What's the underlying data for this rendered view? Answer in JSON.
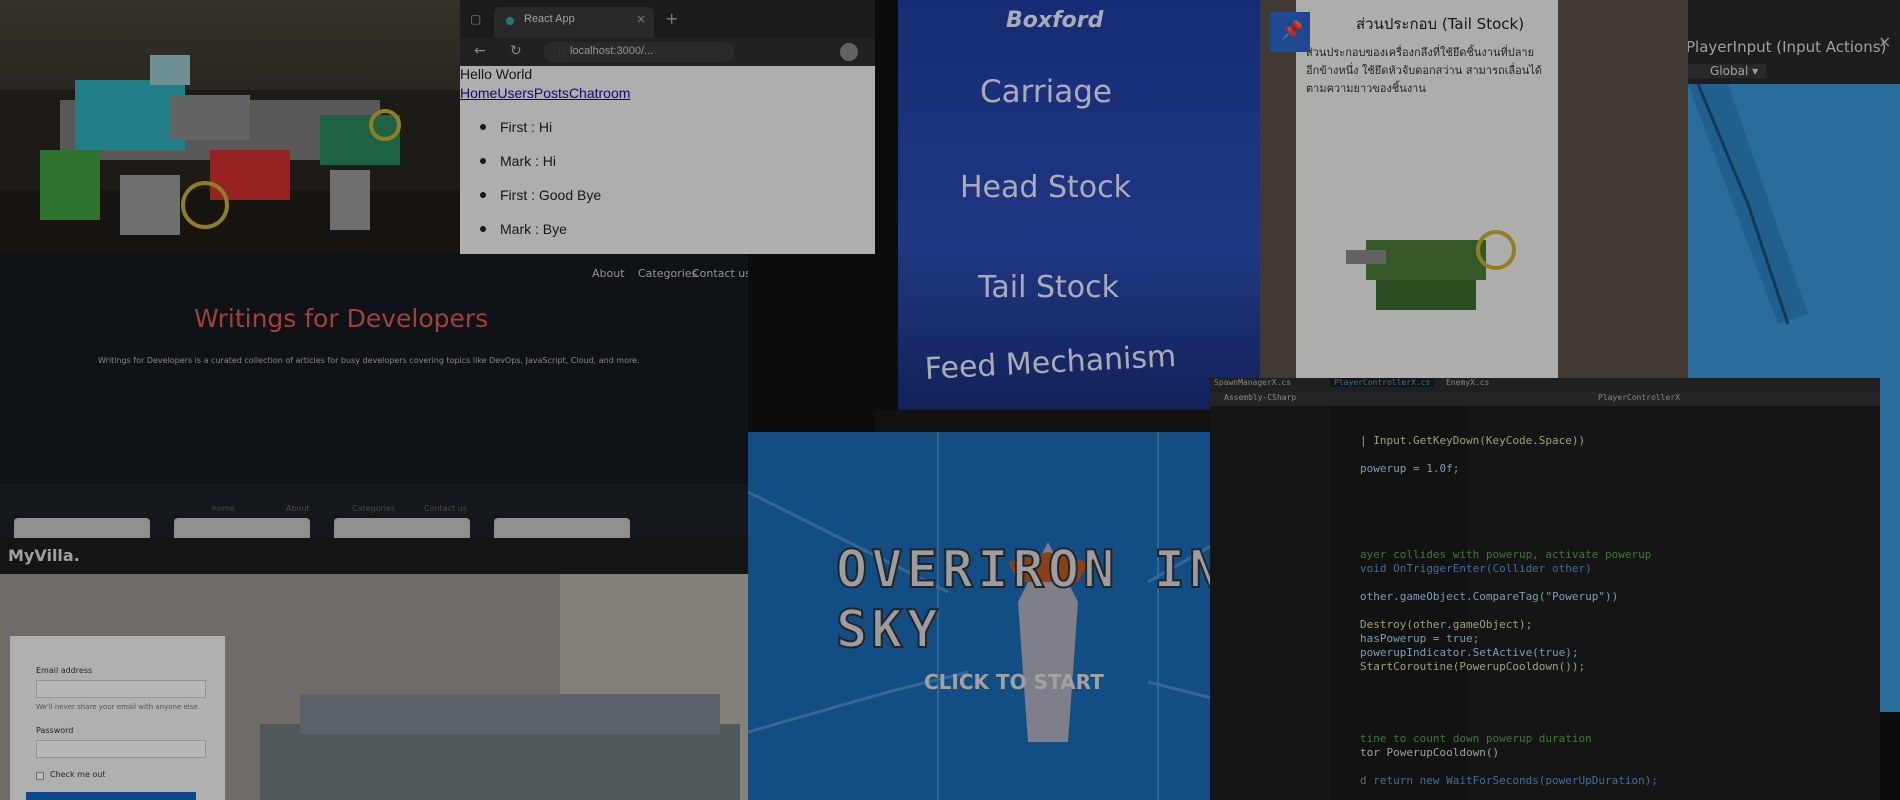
{
  "browser": {
    "tab_title": "React App",
    "url": "localhost:3000/...",
    "hello": "Hello World",
    "nav": [
      "Home",
      "Users",
      "Posts",
      "Chatroom"
    ],
    "messages": [
      "First : Hi",
      "Mark : Hi",
      "First : Good Bye",
      "Mark : Bye"
    ]
  },
  "boxford": {
    "title": "Boxford",
    "items": [
      "Carriage",
      "Head Stock",
      "Tail Stock",
      "Feed Mechanism"
    ]
  },
  "ar_card": {
    "heading": "ส่วนประกอบ (Tail Stock)",
    "body": "ส่วนประกอบของเครื่องกลึงที่ใช้ยึดชิ้นงานที่ปลายอีกข้างหนึ่ง ใช้ยึดหัวจับดอกสว่าน สามารถเลื่อนได้ตามความยาวของชิ้นงาน"
  },
  "unity": {
    "panel_title": "PlayerInput (Input Actions)",
    "global_label": "Global"
  },
  "writings": {
    "nav": [
      "About",
      "Categories",
      "Contact us"
    ],
    "title": "Writings for Developers",
    "description": "Writings for Developers is a curated collection of articles for busy developers covering topics like DevOps, JavaScript, Cloud, and more.",
    "subnav": [
      "home",
      "About",
      "Categories",
      "Contact us"
    ]
  },
  "villa": {
    "brand": "MyVilla.",
    "email_label": "Email address",
    "email_help": "We'll never share your email with anyone else.",
    "password_label": "Password",
    "check_label": "Check me out"
  },
  "game": {
    "title": "OVERIRON IN SKY",
    "start": "CLICK TO START"
  },
  "code": {
    "tabs": [
      "SpawnManagerX.cs",
      "PlayerControllerX.cs",
      "EnemyX.cs"
    ],
    "project": "Assembly-CSharp",
    "class_crumb": "PlayerControllerX",
    "lines": [
      "| Input.GetKeyDown(KeyCode.Space))",
      "powerup = 1.0f;",
      "ayer collides with powerup, activate powerup",
      "void OnTriggerEnter(Collider other)",
      "other.gameObject.CompareTag(\"Powerup\"))",
      "Destroy(other.gameObject);",
      "hasPowerup = true;",
      "powerupIndicator.SetActive(true);",
      "StartCoroutine(PowerupCooldown());",
      "tine to count down powerup duration",
      "tor PowerupCooldown()",
      "d return new WaitForSeconds(powerUpDuration);"
    ]
  },
  "colors": {
    "boxford_blue": "#2c4db4",
    "writings_red": "#e05a4f",
    "game_blue": "#1a6bb8",
    "unity_scene": "#3a98d8",
    "link_blue": "#1a0dab"
  }
}
